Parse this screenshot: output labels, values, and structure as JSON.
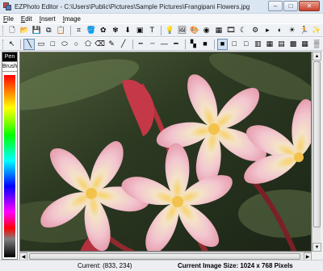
{
  "window": {
    "title": "EZPhoto Editor - C:\\Users\\Public\\Pictures\\Sample Pictures\\Frangipani Flowers.jpg",
    "controls": {
      "minimize": "–",
      "maximize": "□",
      "close": "✕"
    }
  },
  "menu": {
    "items": [
      {
        "label": "File"
      },
      {
        "label": "Edit"
      },
      {
        "label": "Insert"
      },
      {
        "label": "Image"
      }
    ]
  },
  "toolbar_main": {
    "buttons": [
      {
        "icon": "new-file-icon",
        "glyph": "🗋"
      },
      {
        "icon": "open-folder-icon",
        "glyph": "📂"
      },
      {
        "icon": "save-icon",
        "glyph": "💾"
      },
      {
        "icon": "copy-icon",
        "glyph": "⧉"
      },
      {
        "icon": "paste-icon",
        "glyph": "📋"
      },
      {
        "icon": "crop-icon",
        "glyph": "⌗"
      },
      {
        "icon": "paint-bucket-icon",
        "glyph": "🪣"
      },
      {
        "icon": "brush-effects-icon",
        "glyph": "✿"
      },
      {
        "icon": "clear-effects-icon",
        "glyph": "✾"
      },
      {
        "icon": "download-icon",
        "glyph": "⬇"
      },
      {
        "icon": "image-adjust-icon",
        "glyph": "▣"
      },
      {
        "icon": "text-icon",
        "glyph": "T"
      },
      {
        "icon": "bulb-icon",
        "glyph": "💡"
      },
      {
        "icon": "photo-icon",
        "glyph": "🖼"
      },
      {
        "icon": "color-palette-icon",
        "glyph": "🎨"
      },
      {
        "icon": "eye-icon",
        "glyph": "◉"
      },
      {
        "icon": "frame-icon",
        "glyph": "▦"
      },
      {
        "icon": "movie-icon",
        "glyph": "🎞"
      },
      {
        "icon": "moon-icon",
        "glyph": "☾"
      },
      {
        "icon": "gear-icon",
        "glyph": "⚙"
      },
      {
        "icon": "chevron-right-icon",
        "glyph": "▸"
      },
      {
        "icon": "compare-icon",
        "glyph": "◐"
      },
      {
        "icon": "sun-icon",
        "glyph": "☀"
      },
      {
        "icon": "person-icon",
        "glyph": "🏃"
      },
      {
        "icon": "sparkle-icon",
        "glyph": "✨"
      }
    ]
  },
  "toolbar_draw": {
    "buttons": [
      {
        "icon": "select-arrow-icon",
        "glyph": "↖"
      },
      {
        "icon": "line-icon",
        "glyph": "╲"
      },
      {
        "icon": "rectangle-icon",
        "glyph": "▭"
      },
      {
        "icon": "square-icon",
        "glyph": "□"
      },
      {
        "icon": "ellipse-icon",
        "glyph": "⬭"
      },
      {
        "icon": "circle-icon",
        "glyph": "○"
      },
      {
        "icon": "polygon-icon",
        "glyph": "⬠"
      },
      {
        "icon": "eraser-icon",
        "glyph": "⌫"
      },
      {
        "icon": "pencil-icon",
        "glyph": "✎"
      },
      {
        "icon": "diagonal-line-icon",
        "glyph": "╱"
      },
      {
        "icon": "dotted-line-icon",
        "glyph": "┅"
      },
      {
        "icon": "dash-line-icon",
        "glyph": "┄"
      },
      {
        "icon": "thin-line-icon",
        "glyph": "—"
      },
      {
        "icon": "thick-line-icon",
        "glyph": "━"
      },
      {
        "icon": "color-grid-icon",
        "glyph": "▚"
      },
      {
        "icon": "stroke-color-icon",
        "glyph": "■"
      },
      {
        "icon": "fill-black-icon",
        "glyph": "■"
      },
      {
        "icon": "fill-none-icon",
        "glyph": "□"
      },
      {
        "icon": "fill-white-icon",
        "glyph": "□"
      },
      {
        "icon": "fill-pattern-icon",
        "glyph": "▥"
      },
      {
        "icon": "fill-pattern2-icon",
        "glyph": "▦"
      },
      {
        "icon": "fill-hatch-icon",
        "glyph": "▤"
      },
      {
        "icon": "fill-cross-icon",
        "glyph": "▩"
      },
      {
        "icon": "fill-grid-icon",
        "glyph": "▦"
      },
      {
        "icon": "fill-dots-icon",
        "glyph": "▒"
      }
    ]
  },
  "palette": {
    "pen_label": "Pen",
    "brush_label": "Brush"
  },
  "status": {
    "current": "Current: (833, 234)",
    "image_size": "Current Image Size: 1024 x 768 Pixels"
  },
  "colors": {
    "title_bar": "#dbe6f3",
    "selection": "#cfe0f3",
    "close_button": "#c7402c"
  }
}
